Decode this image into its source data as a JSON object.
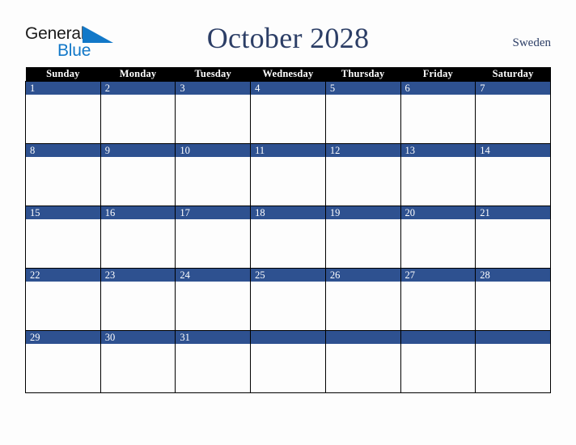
{
  "brand": {
    "name_part1": "General",
    "name_part2": "Blue",
    "triangle_icon": "blue-triangle-icon",
    "color_dark": "#1b1b1b",
    "color_blue": "#1278c8"
  },
  "header": {
    "month_title": "October 2028",
    "country": "Sweden",
    "title_color": "#2c3e66"
  },
  "calendar": {
    "weekday_headers": [
      "Sunday",
      "Monday",
      "Tuesday",
      "Wednesday",
      "Thursday",
      "Friday",
      "Saturday"
    ],
    "header_bg": "#000000",
    "header_fg": "#ffffff",
    "daynum_bg": "#2e5190",
    "daynum_fg": "#ffffff",
    "cell_bg": "#fdfdfd",
    "grid_line": "#000000",
    "weeks": [
      [
        "1",
        "2",
        "3",
        "4",
        "5",
        "6",
        "7"
      ],
      [
        "8",
        "9",
        "10",
        "11",
        "12",
        "13",
        "14"
      ],
      [
        "15",
        "16",
        "17",
        "18",
        "19",
        "20",
        "21"
      ],
      [
        "22",
        "23",
        "24",
        "25",
        "26",
        "27",
        "28"
      ],
      [
        "29",
        "30",
        "31",
        "",
        "",
        "",
        ""
      ]
    ]
  }
}
